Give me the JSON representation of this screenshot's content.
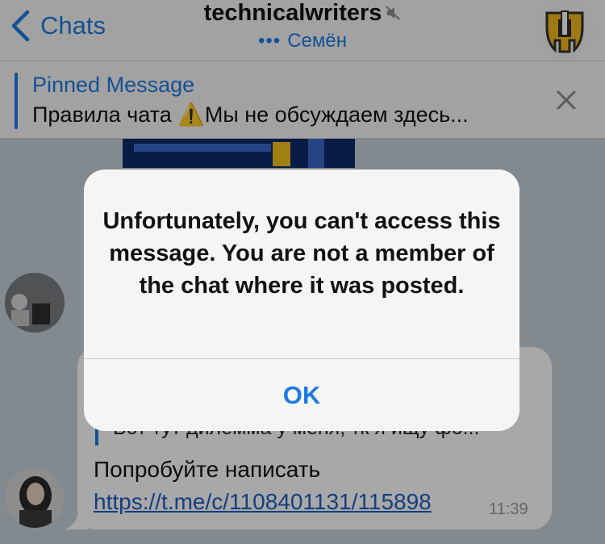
{
  "header": {
    "back_label": "Chats",
    "title": "technicalwriters",
    "subtitle_dots": "•••",
    "subtitle_name": "Семён"
  },
  "pinned": {
    "title": "Pinned Message",
    "text": "Правила чата ⚠️Мы не обсуждаем здесь..."
  },
  "message": {
    "reply_text": "Вот тут дилемма у меня, тк я ищу фо...",
    "text_prefix": "Попробуйте написать ",
    "link": "https://t.me/c/1108401131/115898",
    "time": "11:39"
  },
  "alert": {
    "message": "Unfortunately, you can't access this message. You are not a member of the chat where it was posted.",
    "ok_label": "OK"
  },
  "colors": {
    "accent": "#1f7be0",
    "link": "#1f5fbf",
    "navbar_bg": "#f6f6f7",
    "chat_bg": "#c6d2da"
  },
  "icons": [
    "chevron-left-icon",
    "mute-icon",
    "close-icon",
    "warning-icon"
  ]
}
